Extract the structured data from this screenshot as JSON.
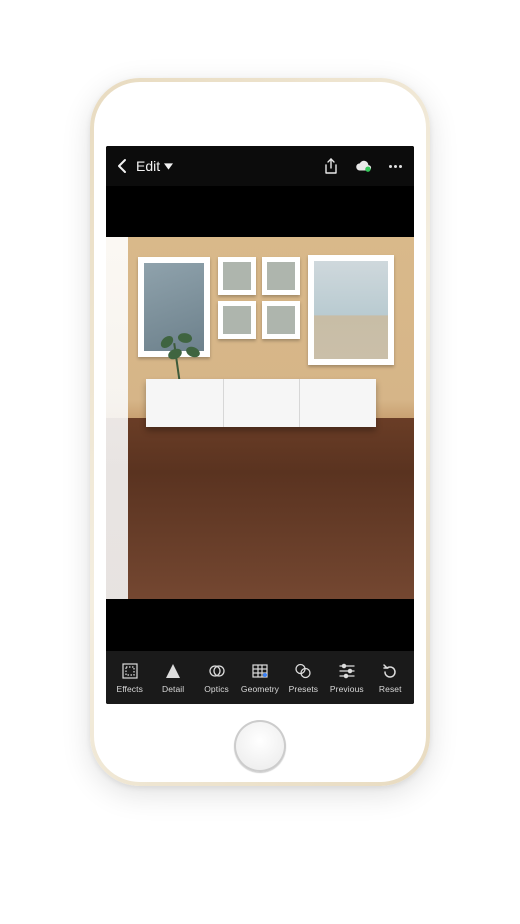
{
  "header": {
    "title": "Edit",
    "icons": {
      "back": "chevron-left-icon",
      "dropdown": "triangle-down-icon",
      "share": "share-icon",
      "cloud": "cloud-sync-icon",
      "more": "more-icon"
    },
    "cloud_status_color": "#34c759"
  },
  "toolbar": [
    {
      "id": "effects",
      "label": "Effects"
    },
    {
      "id": "detail",
      "label": "Detail"
    },
    {
      "id": "optics",
      "label": "Optics"
    },
    {
      "id": "geometry",
      "label": "Geometry"
    },
    {
      "id": "presets",
      "label": "Presets"
    },
    {
      "id": "previous",
      "label": "Previous"
    },
    {
      "id": "reset",
      "label": "Reset"
    }
  ]
}
